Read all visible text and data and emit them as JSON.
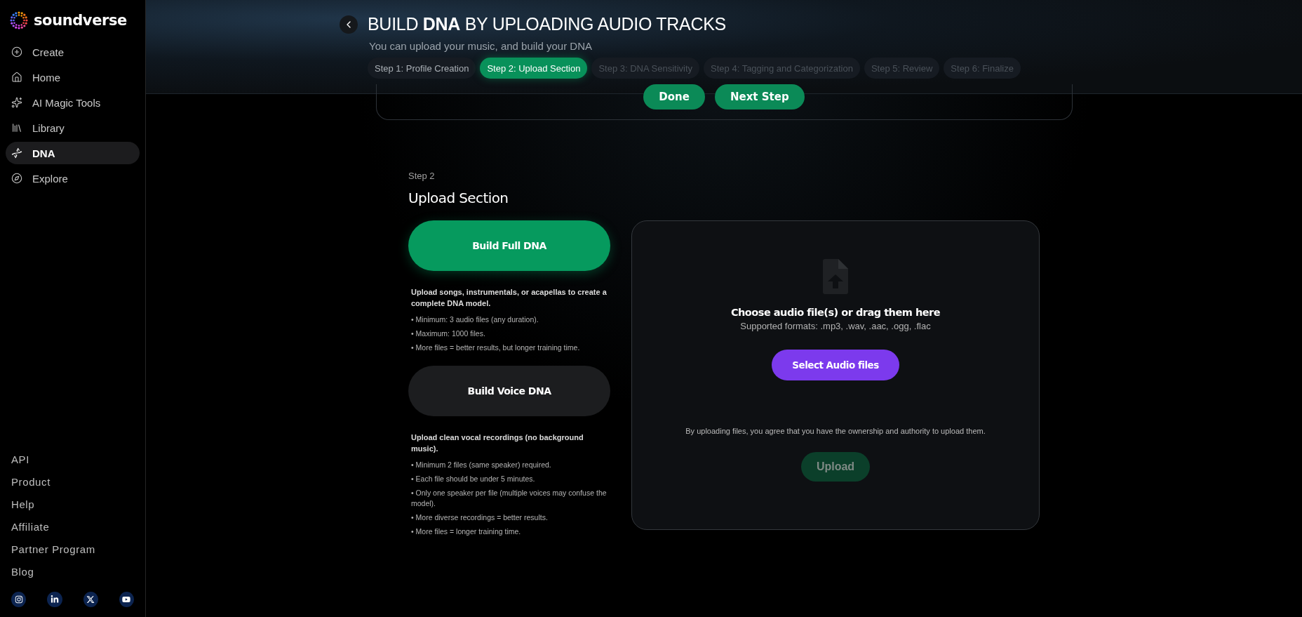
{
  "brand": {
    "name": "soundverse"
  },
  "nav": [
    {
      "label": "Create",
      "kind": "create",
      "selected": false
    },
    {
      "label": "Home",
      "kind": "home",
      "selected": false
    },
    {
      "label": "AI Magic Tools",
      "kind": "magic",
      "selected": false
    },
    {
      "label": "Library",
      "kind": "library",
      "selected": false
    },
    {
      "label": "DNA",
      "kind": "dna",
      "selected": true
    },
    {
      "label": "Explore",
      "kind": "explore",
      "selected": false
    }
  ],
  "footer_links": [
    "API",
    "Product",
    "Help",
    "Affiliate",
    "Partner Program",
    "Blog"
  ],
  "header": {
    "title": "BUILD **DNA** BY UPLOADING AUDIO TRACKS",
    "subtitle": "You can upload your music, and build your DNA",
    "steps": [
      {
        "label": "Step 1: Profile Creation",
        "selected": false,
        "disabled": false
      },
      {
        "label": "Step 2: Upload Section",
        "selected": true,
        "disabled": false
      },
      {
        "label": "Step 3: DNA Sensitivity",
        "selected": false,
        "disabled": true
      },
      {
        "label": "Step 4: Tagging and Categorization",
        "selected": false,
        "disabled": true
      },
      {
        "label": "Step 5: Review",
        "selected": false,
        "disabled": true
      },
      {
        "label": "Step 6: Finalize",
        "selected": false,
        "disabled": true
      }
    ]
  },
  "previous_card": {
    "buttons": [
      "Done",
      "Next Step"
    ]
  },
  "section": {
    "eyebrow": "Step 2",
    "title": "Upload Section",
    "options": [
      {
        "label": "Build Full DNA",
        "selected": true,
        "description": "Upload songs, instrumentals, or acapellas to create a complete DNA model.",
        "bullets": [
          "• Minimum: 3 audio files (any duration).",
          "• Maximum: 1000 files.",
          "• More files = better results, but longer training time."
        ]
      },
      {
        "label": "Build Voice DNA",
        "selected": false,
        "description": "Upload clean vocal recordings (no background music).",
        "bullets": [
          "• Minimum 2 files (same speaker) required.",
          "• Each file should be under 5 minutes.",
          "• Only one speaker per file (multiple voices may confuse the model).",
          "• More diverse recordings = better results.",
          "• More files = longer training time."
        ]
      }
    ],
    "dropzone": {
      "title": "Choose audio file(s) or drag them here",
      "formats": "Supported formats: .mp3, .wav, .aac, .ogg, .flac",
      "select_button": "Select Audio files",
      "agreement": "By uploading files, you agree that you have the ownership and authority to upload them.",
      "upload_button": {
        "label": "Upload",
        "disabled": true
      }
    }
  }
}
